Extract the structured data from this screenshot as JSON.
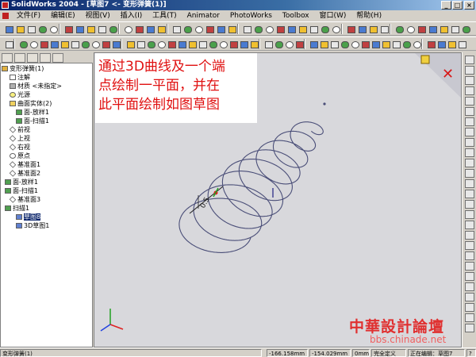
{
  "window": {
    "title": "SolidWorks 2004 - [草图7 <- 变形弹簧(1)]",
    "minimize": "_",
    "maximize": "□",
    "close": "×"
  },
  "menu": [
    "文件(F)",
    "编辑(E)",
    "视图(V)",
    "插入(I)",
    "工具(T)",
    "Animator",
    "PhotoWorks",
    "Toolbox",
    "窗口(W)",
    "帮助(H)"
  ],
  "tree": {
    "items": [
      {
        "label": "变形弹簧(1)",
        "icon": "part-icon"
      },
      {
        "label": "注解",
        "icon": "annotations-icon"
      },
      {
        "label": "材质 <未指定>",
        "icon": "material-icon"
      },
      {
        "label": "光源",
        "icon": "lighting-icon"
      },
      {
        "label": "曲面实体(2)",
        "icon": "surface-bodies-icon"
      },
      {
        "label": "面-放样1",
        "icon": "surface-icon"
      },
      {
        "label": "面-扫描1",
        "icon": "surface-icon"
      },
      {
        "label": "前视",
        "icon": "plane-icon"
      },
      {
        "label": "上视",
        "icon": "plane-icon"
      },
      {
        "label": "右视",
        "icon": "plane-icon"
      },
      {
        "label": "原点",
        "icon": "origin-icon"
      },
      {
        "label": "基准面1",
        "icon": "plane-icon"
      },
      {
        "label": "基准面2",
        "icon": "plane-icon"
      },
      {
        "label": "面-放样1",
        "icon": "surface-icon"
      },
      {
        "label": "面-扫描1",
        "icon": "surface-icon"
      },
      {
        "label": "基准面3",
        "icon": "plane-icon"
      },
      {
        "label": "扫描1",
        "icon": "sweep-icon"
      },
      {
        "label": "草图8",
        "icon": "sketch-icon"
      },
      {
        "label": "3D草图1",
        "icon": "sketch3d-icon"
      }
    ]
  },
  "annotation": {
    "lines": [
      "通过3D曲线及一个端",
      "点绘制一平面，并在",
      "此平面绘制如图草图"
    ]
  },
  "sketch": {
    "dimension_text": "0.5"
  },
  "status": {
    "part_name": "变形弹簧(1)",
    "x": "-166.158mm",
    "y": "-154.029mm",
    "z": "0mm",
    "state": "完全定义",
    "editing": "正在编辑：草图7",
    "question": "?"
  },
  "watermark": {
    "site_name": "中華設計論壇",
    "url": "bbs.chinade.net"
  },
  "colors": {
    "annotation_text": "#e01010",
    "watermark": "#e03030",
    "helix": "#4a4e78"
  }
}
